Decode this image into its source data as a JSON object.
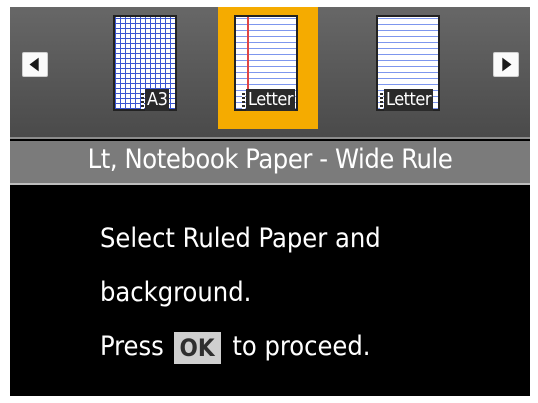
{
  "carousel": {
    "prev_icon": "arrow-left-icon",
    "next_icon": "arrow-right-icon",
    "items": [
      {
        "size": "A3",
        "style": "grid",
        "selected": false
      },
      {
        "size": "Letter",
        "style": "ruled-margin",
        "selected": true
      },
      {
        "size": "Letter",
        "style": "ruled",
        "selected": false
      }
    ]
  },
  "info_bar": {
    "text": "Lt, Notebook Paper - Wide Rule"
  },
  "message": {
    "line1": "Select Ruled Paper and",
    "line2": "background.",
    "line3_prefix": "Press",
    "ok_label": "OK",
    "line3_suffix": "to proceed."
  },
  "colors": {
    "selection": "#f5ab00",
    "screen": "#000000",
    "bar": "#5a5a5a",
    "info_bar": "#7b7b7b"
  }
}
